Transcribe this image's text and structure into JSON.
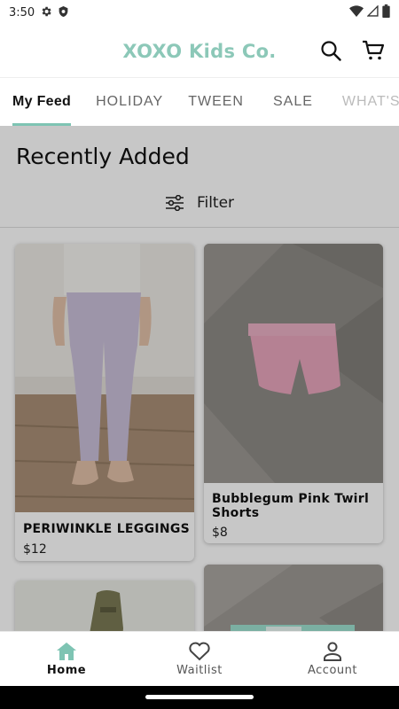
{
  "status_bar": {
    "time": "3:50"
  },
  "header": {
    "brand": "XOXO Kids Co."
  },
  "colors": {
    "brand": "#8cc8b8",
    "accent": "#7ec4b3"
  },
  "tabs": [
    {
      "label": "My Feed",
      "active": true
    },
    {
      "label": "HOLIDAY",
      "active": false
    },
    {
      "label": "TWEEN",
      "active": false
    },
    {
      "label": "SALE",
      "active": false
    },
    {
      "label": "WHAT'S N",
      "active": false
    }
  ],
  "section": {
    "title": "Recently Added",
    "filter_label": "Filter"
  },
  "products": [
    {
      "name": "PERIWINKLE LEGGINGS",
      "price": "$12"
    },
    {
      "name": "Bubblegum Pink Twirl Shorts",
      "price": "$8"
    }
  ],
  "bottom_nav": [
    {
      "label": "Home",
      "icon": "home-icon",
      "active": true
    },
    {
      "label": "Waitlist",
      "icon": "heart-icon",
      "active": false
    },
    {
      "label": "Account",
      "icon": "person-icon",
      "active": false
    }
  ]
}
